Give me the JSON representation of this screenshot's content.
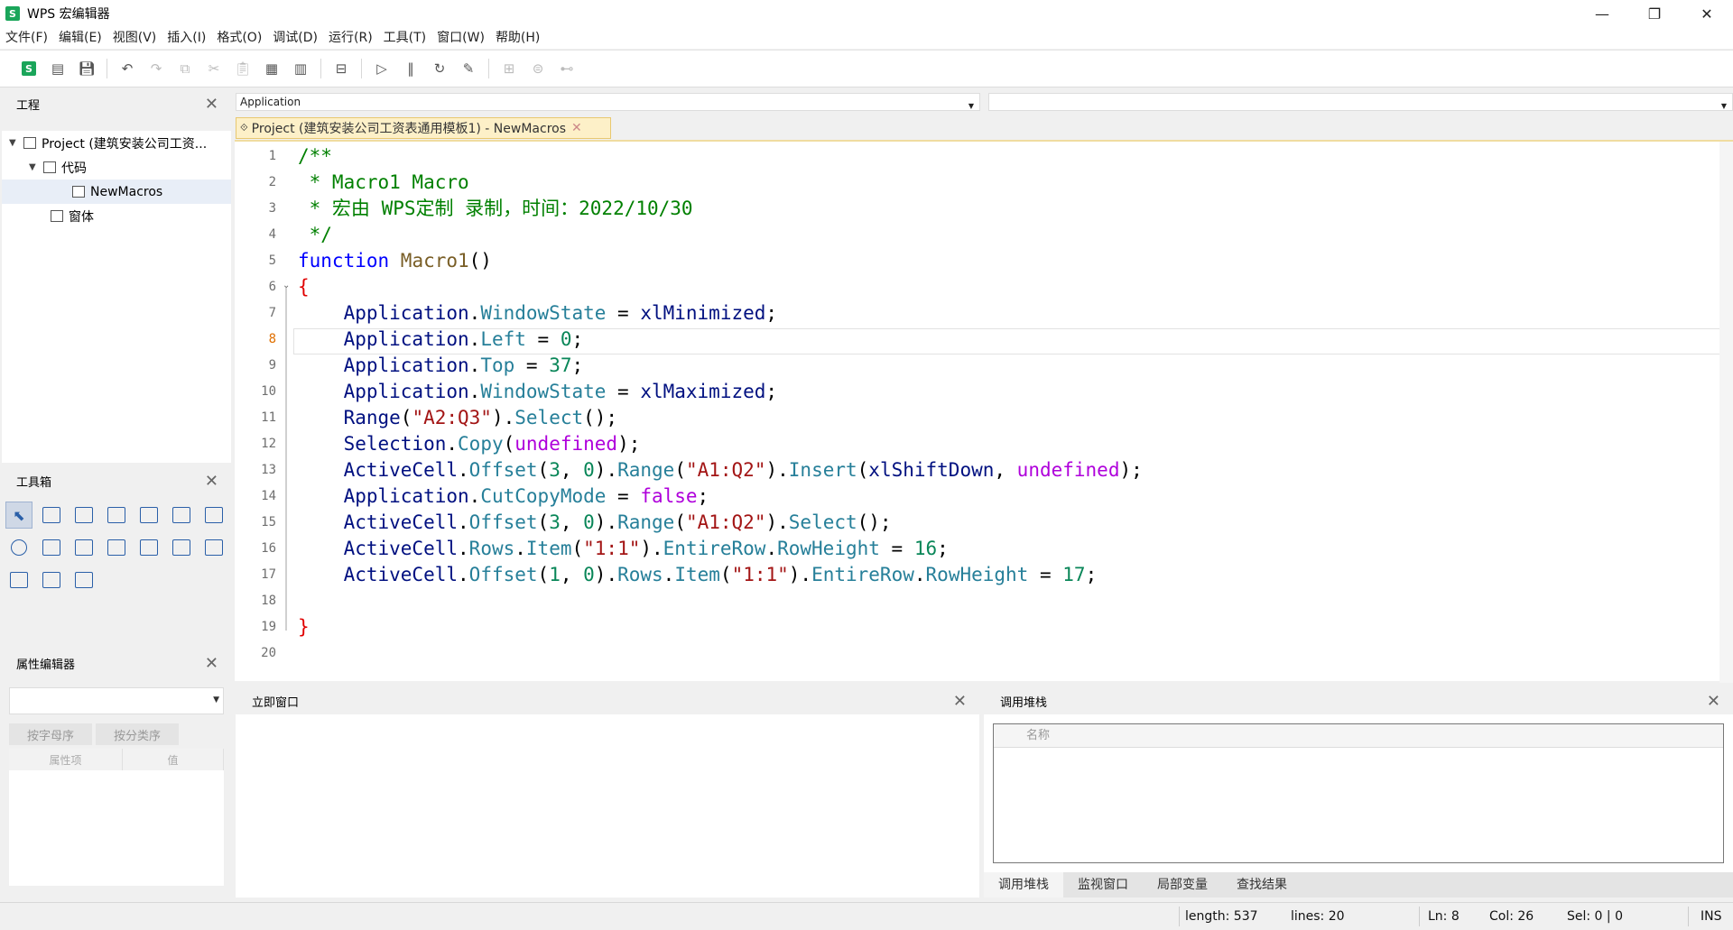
{
  "window": {
    "title": "WPS 宏编辑器",
    "logo": "S",
    "minimize": "—",
    "restore": "❐",
    "close": "✕"
  },
  "menu": [
    "文件(F)",
    "编辑(E)",
    "视图(V)",
    "插入(I)",
    "格式(O)",
    "调试(D)",
    "运行(R)",
    "工具(T)",
    "窗口(W)",
    "帮助(H)"
  ],
  "toolbar": {
    "logo": "S"
  },
  "project_panel": {
    "title": "工程",
    "items": [
      "Project (建筑安装公司工资...",
      "代码",
      "NewMacros",
      "窗体"
    ]
  },
  "toolbox": {
    "title": "工具箱"
  },
  "property_editor": {
    "title": "属性编辑器",
    "tab_alpha": "按字母序",
    "tab_category": "按分类序",
    "col_name": "属性项",
    "col_value": "值"
  },
  "object_selector": {
    "value": "Application"
  },
  "document_tab": {
    "label": "Project (建筑安装公司工资表通用模板1) - NewMacros"
  },
  "editor": {
    "current_line": 8,
    "lines": [
      [
        [
          "c-cm",
          "/**"
        ]
      ],
      [
        [
          "c-cm",
          " * Macro1 Macro"
        ]
      ],
      [
        [
          "c-cm",
          " * 宏由 WPS定制 录制，时间：2022/10/30"
        ]
      ],
      [
        [
          "c-cm",
          " */"
        ]
      ],
      [
        [
          "c-kw",
          "function "
        ],
        [
          "c-fn",
          "Macro1"
        ],
        [
          "c-pl",
          "()"
        ]
      ],
      [
        [
          "c-br",
          "{"
        ]
      ],
      [
        [
          "c-pl",
          "    "
        ],
        [
          "c-obj",
          "Application"
        ],
        [
          "c-pl",
          "."
        ],
        [
          "c-pr",
          "WindowState"
        ],
        [
          "c-pl",
          " = "
        ],
        [
          "c-obj",
          "xlMinimized"
        ],
        [
          "c-pl",
          ";"
        ]
      ],
      [
        [
          "c-pl",
          "    "
        ],
        [
          "c-obj",
          "Application"
        ],
        [
          "c-pl",
          "."
        ],
        [
          "c-pr",
          "Left"
        ],
        [
          "c-pl",
          " = "
        ],
        [
          "c-num",
          "0"
        ],
        [
          "c-pl",
          ";"
        ]
      ],
      [
        [
          "c-pl",
          "    "
        ],
        [
          "c-obj",
          "Application"
        ],
        [
          "c-pl",
          "."
        ],
        [
          "c-pr",
          "Top"
        ],
        [
          "c-pl",
          " = "
        ],
        [
          "c-num",
          "37"
        ],
        [
          "c-pl",
          ";"
        ]
      ],
      [
        [
          "c-pl",
          "    "
        ],
        [
          "c-obj",
          "Application"
        ],
        [
          "c-pl",
          "."
        ],
        [
          "c-pr",
          "WindowState"
        ],
        [
          "c-pl",
          " = "
        ],
        [
          "c-obj",
          "xlMaximized"
        ],
        [
          "c-pl",
          ";"
        ]
      ],
      [
        [
          "c-pl",
          "    "
        ],
        [
          "c-obj",
          "Range"
        ],
        [
          "c-pl",
          "("
        ],
        [
          "c-str",
          "\"A2:Q3\""
        ],
        [
          "c-pl",
          ")."
        ],
        [
          "c-pr",
          "Select"
        ],
        [
          "c-pl",
          "();"
        ]
      ],
      [
        [
          "c-pl",
          "    "
        ],
        [
          "c-obj",
          "Selection"
        ],
        [
          "c-pl",
          "."
        ],
        [
          "c-pr",
          "Copy"
        ],
        [
          "c-pl",
          "("
        ],
        [
          "c-sp",
          "undefined"
        ],
        [
          "c-pl",
          ");"
        ]
      ],
      [
        [
          "c-pl",
          "    "
        ],
        [
          "c-obj",
          "ActiveCell"
        ],
        [
          "c-pl",
          "."
        ],
        [
          "c-pr",
          "Offset"
        ],
        [
          "c-pl",
          "("
        ],
        [
          "c-num",
          "3"
        ],
        [
          "c-pl",
          ", "
        ],
        [
          "c-num",
          "0"
        ],
        [
          "c-pl",
          ")."
        ],
        [
          "c-pr",
          "Range"
        ],
        [
          "c-pl",
          "("
        ],
        [
          "c-str",
          "\"A1:Q2\""
        ],
        [
          "c-pl",
          ")."
        ],
        [
          "c-pr",
          "Insert"
        ],
        [
          "c-pl",
          "("
        ],
        [
          "c-obj",
          "xlShiftDown"
        ],
        [
          "c-pl",
          ", "
        ],
        [
          "c-sp",
          "undefined"
        ],
        [
          "c-pl",
          ");"
        ]
      ],
      [
        [
          "c-pl",
          "    "
        ],
        [
          "c-obj",
          "Application"
        ],
        [
          "c-pl",
          "."
        ],
        [
          "c-pr",
          "CutCopyMode"
        ],
        [
          "c-pl",
          " = "
        ],
        [
          "c-sp",
          "false"
        ],
        [
          "c-pl",
          ";"
        ]
      ],
      [
        [
          "c-pl",
          "    "
        ],
        [
          "c-obj",
          "ActiveCell"
        ],
        [
          "c-pl",
          "."
        ],
        [
          "c-pr",
          "Offset"
        ],
        [
          "c-pl",
          "("
        ],
        [
          "c-num",
          "3"
        ],
        [
          "c-pl",
          ", "
        ],
        [
          "c-num",
          "0"
        ],
        [
          "c-pl",
          ")."
        ],
        [
          "c-pr",
          "Range"
        ],
        [
          "c-pl",
          "("
        ],
        [
          "c-str",
          "\"A1:Q2\""
        ],
        [
          "c-pl",
          ")."
        ],
        [
          "c-pr",
          "Select"
        ],
        [
          "c-pl",
          "();"
        ]
      ],
      [
        [
          "c-pl",
          "    "
        ],
        [
          "c-obj",
          "ActiveCell"
        ],
        [
          "c-pl",
          "."
        ],
        [
          "c-pr",
          "Rows"
        ],
        [
          "c-pl",
          "."
        ],
        [
          "c-pr",
          "Item"
        ],
        [
          "c-pl",
          "("
        ],
        [
          "c-str",
          "\"1:1\""
        ],
        [
          "c-pl",
          ")."
        ],
        [
          "c-pr",
          "EntireRow"
        ],
        [
          "c-pl",
          "."
        ],
        [
          "c-pr",
          "RowHeight"
        ],
        [
          "c-pl",
          " = "
        ],
        [
          "c-num",
          "16"
        ],
        [
          "c-pl",
          ";"
        ]
      ],
      [
        [
          "c-pl",
          "    "
        ],
        [
          "c-obj",
          "ActiveCell"
        ],
        [
          "c-pl",
          "."
        ],
        [
          "c-pr",
          "Offset"
        ],
        [
          "c-pl",
          "("
        ],
        [
          "c-num",
          "1"
        ],
        [
          "c-pl",
          ", "
        ],
        [
          "c-num",
          "0"
        ],
        [
          "c-pl",
          ")."
        ],
        [
          "c-pr",
          "Rows"
        ],
        [
          "c-pl",
          "."
        ],
        [
          "c-pr",
          "Item"
        ],
        [
          "c-pl",
          "("
        ],
        [
          "c-str",
          "\"1:1\""
        ],
        [
          "c-pl",
          ")."
        ],
        [
          "c-pr",
          "EntireRow"
        ],
        [
          "c-pl",
          "."
        ],
        [
          "c-pr",
          "RowHeight"
        ],
        [
          "c-pl",
          " = "
        ],
        [
          "c-num",
          "17"
        ],
        [
          "c-pl",
          ";"
        ]
      ],
      [
        [
          "c-pl",
          ""
        ]
      ],
      [
        [
          "c-br",
          "}"
        ]
      ],
      [
        [
          "c-pl",
          ""
        ]
      ]
    ]
  },
  "immediate": {
    "title": "立即窗口"
  },
  "callstack": {
    "title": "调用堆栈",
    "col_name": "名称",
    "tabs": [
      "调用堆栈",
      "监视窗口",
      "局部变量",
      "查找结果"
    ]
  },
  "status": {
    "length": "length: 537",
    "lines": "lines: 20",
    "ln": "Ln: 8",
    "col": "Col: 26",
    "sel": "Sel: 0 | 0",
    "mode": "INS"
  }
}
